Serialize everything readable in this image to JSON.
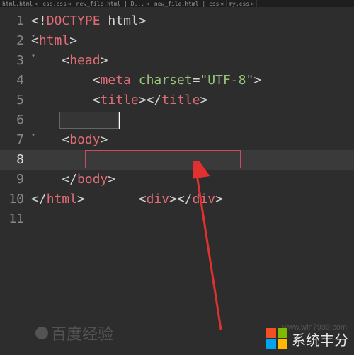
{
  "tabs": [
    {
      "label": "html.html"
    },
    {
      "label": "css.css"
    },
    {
      "label": "new_file.html | D..."
    },
    {
      "label": "new_file.html | css"
    },
    {
      "label": "my.css"
    }
  ],
  "lines": {
    "l1": {
      "num": "1"
    },
    "l2": {
      "num": "2"
    },
    "l3": {
      "num": "3"
    },
    "l4": {
      "num": "4"
    },
    "l5": {
      "num": "5"
    },
    "l6": {
      "num": "6"
    },
    "l7": {
      "num": "7"
    },
    "l8": {
      "num": "8"
    },
    "l9": {
      "num": "9"
    },
    "l10": {
      "num": "10"
    },
    "l11": {
      "num": "11"
    }
  },
  "tokens": {
    "lt": "<",
    "gt": ">",
    "slash": "/",
    "bang": "!",
    "eq": "=",
    "q": "\"",
    "doctype": "DOCTYPE",
    "html_kw": "html",
    "html": "html",
    "head": "head",
    "meta": "meta",
    "charset_attr": "charset",
    "utf8": "UTF-8",
    "title": "title",
    "body": "body",
    "div": "div"
  },
  "watermark": {
    "baidu": "百度经验",
    "url": "www.win7999.com",
    "right": "系统丰分"
  }
}
